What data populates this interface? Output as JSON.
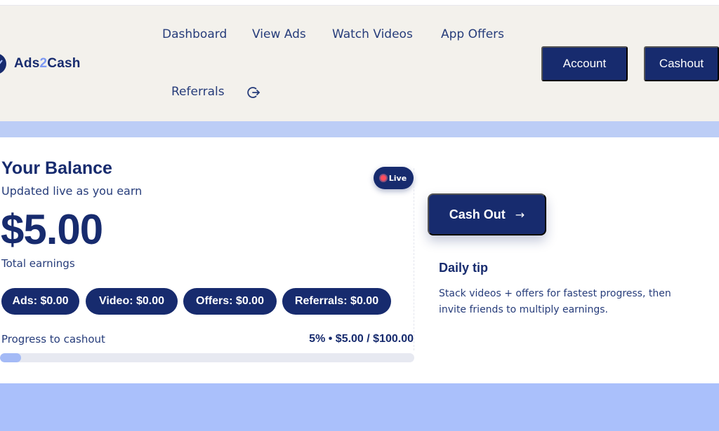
{
  "header": {
    "logo": {
      "text_prefix": "Ads",
      "text_accent": "2",
      "text_suffix": "Cash"
    },
    "nav": {
      "dashboard": "Dashboard",
      "view_ads": "View Ads",
      "watch_videos": "Watch Videos",
      "app_offers": "App Offers",
      "referrals": "Referrals",
      "logout_icon": "logout-icon"
    },
    "buttons": {
      "account": "Account",
      "cashout": "Cashout"
    }
  },
  "balance": {
    "title": "Your Balance",
    "subtitle": "Updated live as you earn",
    "live_badge": "Live",
    "amount": "$5.00",
    "amount_caption": "Total earnings",
    "breakdown": {
      "ads": "Ads: $0.00",
      "video": "Video: $0.00",
      "offers": "Offers: $0.00",
      "referrals": "Referrals: $0.00"
    },
    "progress": {
      "label": "Progress to cashout",
      "summary": "5% • $5.00 / $100.00",
      "fraction": 0.05
    }
  },
  "side": {
    "cashout_button": "Cash Out",
    "cashout_arrow": "→",
    "tip_title": "Daily tip",
    "tip_text": "Stack videos + offers for fastest progress, then invite friends to multiply earnings."
  },
  "colors": {
    "primary": "#172b6e",
    "accent": "#7d99f3",
    "header_bg": "#f3f1ec",
    "page_bg": "#aac0fb",
    "live_dot": "#ff4d5e"
  }
}
